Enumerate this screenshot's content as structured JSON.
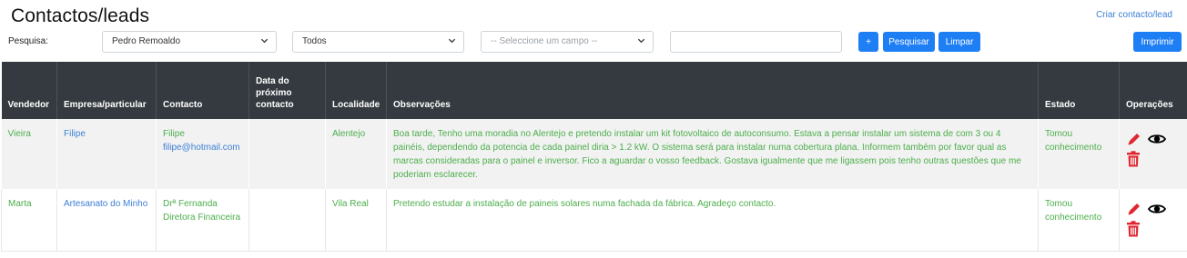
{
  "page": {
    "title": "Contactos/leads",
    "create_link": "Criar contacto/lead"
  },
  "filters": {
    "search_label": "Pesquisa:",
    "seller_select": "Pedro Remoaldo",
    "status_select": "Todos",
    "field_select": "-- Seleccione um campo --",
    "search_value": "",
    "plus_label": "+",
    "search_button": "Pesquisar",
    "clear_button": "Limpar",
    "print_button": "Imprimir"
  },
  "table": {
    "headers": [
      "Vendedor",
      "Empresa/particular",
      "Contacto",
      "Data do próximo contacto",
      "Localidade",
      "Observações",
      "Estado",
      "Operações"
    ],
    "rows": [
      {
        "vendedor": "Vieira",
        "empresa": "Filipe",
        "contacto_nome": "Filipe",
        "contacto_email": "filipe@hotmail.com",
        "data": "",
        "localidade": "Alentejo",
        "observacoes": "Boa tarde, Tenho uma moradia no Alentejo e pretendo instalar um kit fotovoltaico de autoconsumo. Estava a pensar instalar um sistema de com 3 ou 4 painéis, dependendo da potencia de cada painel diria > 1.2 kW. O sistema será para instalar numa cobertura plana. Informem também por favor qual as marcas consideradas para o painel e inversor. Fico a aguardar o vosso feedback. Gostava igualmente que me ligassem pois tenho outras questões que me poderiam esclarecer.",
        "estado": "Tomou conhecimento"
      },
      {
        "vendedor": "Marta",
        "empresa": "Artesanato do Minho",
        "contacto_nome": "Drª Fernanda",
        "contacto_email": "Diretora Financeira",
        "data": "",
        "localidade": "Vila Real",
        "observacoes": "Pretendo estudar a instalação de paineis solares numa fachada da fábrica. Agradeço contacto.",
        "estado": "Tomou conhecimento"
      }
    ]
  },
  "icons": {
    "edit": "pencil-icon",
    "view": "eye-icon",
    "delete": "trash-icon"
  },
  "colors": {
    "header_bg": "#343a40",
    "primary": "#1e7ff5",
    "green_text": "#4cae4c",
    "blue_text": "#3d7fd6",
    "edit_red": "#e0262e"
  }
}
